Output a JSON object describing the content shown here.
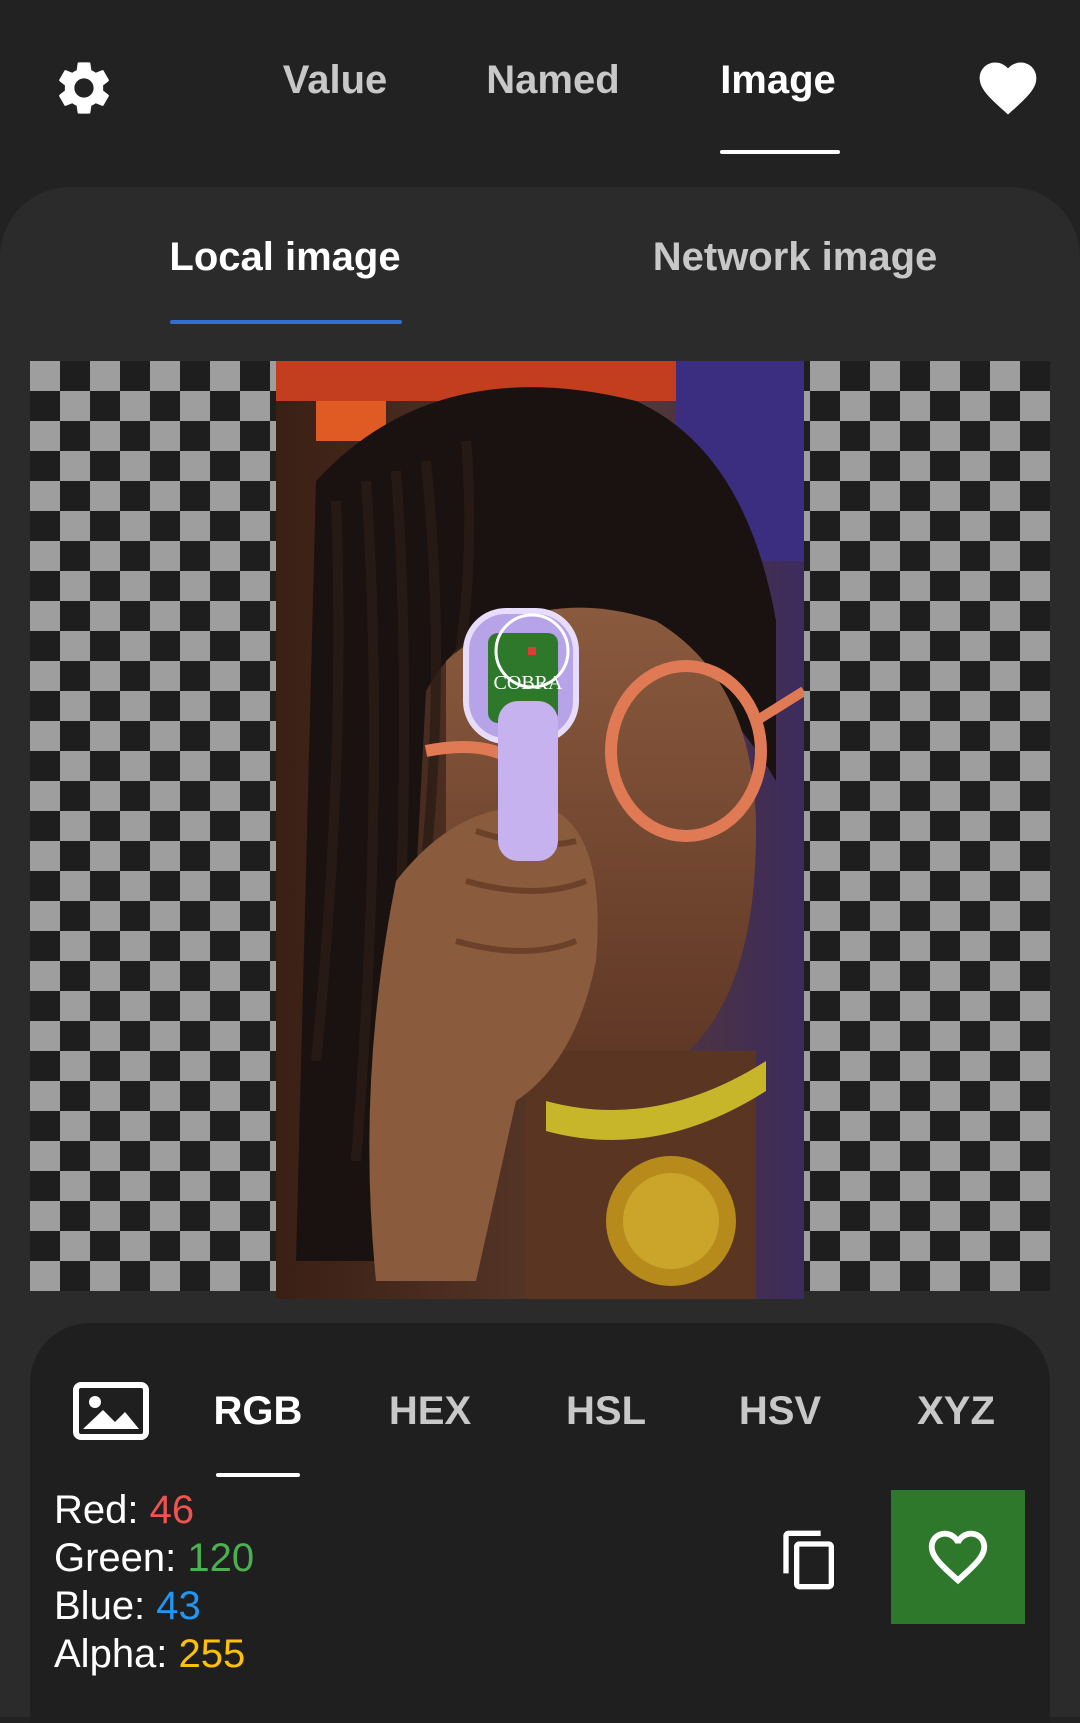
{
  "top_tabs": [
    {
      "label": "Value",
      "active": false
    },
    {
      "label": "Named",
      "active": false
    },
    {
      "label": "Image",
      "active": true
    }
  ],
  "icons": {
    "settings": "gear-icon",
    "favorites": "heart-filled-icon",
    "pick_image": "image-icon",
    "copy": "copy-icon",
    "add_favorite": "heart-outline-icon"
  },
  "image_source_tabs": [
    {
      "label": "Local image",
      "active": true
    },
    {
      "label": "Network image",
      "active": false
    }
  ],
  "preview": {
    "overlay_text": "COBRA"
  },
  "format_tabs": [
    {
      "label": "RGB",
      "active": true
    },
    {
      "label": "HEX",
      "active": false
    },
    {
      "label": "HSL",
      "active": false
    },
    {
      "label": "HSV",
      "active": false
    },
    {
      "label": "XYZ",
      "active": false
    }
  ],
  "color_values": {
    "red_label": "Red:",
    "red_value": "46",
    "green_label": "Green:",
    "green_value": "120",
    "blue_label": "Blue:",
    "blue_value": "43",
    "alpha_label": "Alpha:",
    "alpha_value": "255"
  },
  "colors": {
    "background": "#222222",
    "sheet": "#2b2b2b",
    "accent_blue": "#2f6fd6",
    "picked_color": "#2e782b",
    "red_text": "#ef5350",
    "green_text": "#4caf50",
    "blue_text": "#2196f3",
    "alpha_text": "#ffc107"
  }
}
